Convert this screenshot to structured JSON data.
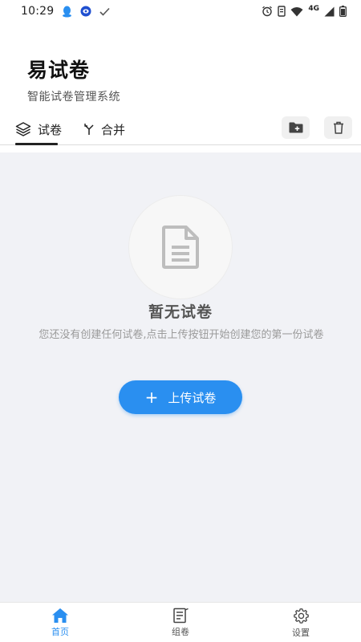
{
  "status_bar": {
    "time": "10:29",
    "network": "4G",
    "left_icons": [
      "qq-icon",
      "message-icon",
      "check-icon"
    ],
    "right_icons": [
      "alarm-icon",
      "vibrate-icon",
      "wifi-icon",
      "signal-icon",
      "battery-icon"
    ]
  },
  "header": {
    "title": "易试卷",
    "subtitle": "智能试卷管理系统"
  },
  "tabs": [
    {
      "label": "试卷",
      "icon": "layers-icon",
      "active": true
    },
    {
      "label": "合并",
      "icon": "merge-icon",
      "active": false
    }
  ],
  "toolbar": {
    "add_folder_icon": "folder-add-icon",
    "delete_icon": "trash-icon"
  },
  "empty_state": {
    "icon": "document-icon",
    "title": "暂无试卷",
    "description": "您还没有创建任何试卷,点击上传按钮开始创建您的第一份试卷",
    "button_label": "上传试卷",
    "button_color": "#2a8ff0"
  },
  "bottom_nav": [
    {
      "label": "首页",
      "icon": "home-icon",
      "active": true
    },
    {
      "label": "组卷",
      "icon": "compose-icon",
      "active": false
    },
    {
      "label": "设置",
      "icon": "gear-icon",
      "active": false
    }
  ],
  "colors": {
    "accent": "#2a8ff0",
    "content_bg": "#f1f2f6"
  }
}
